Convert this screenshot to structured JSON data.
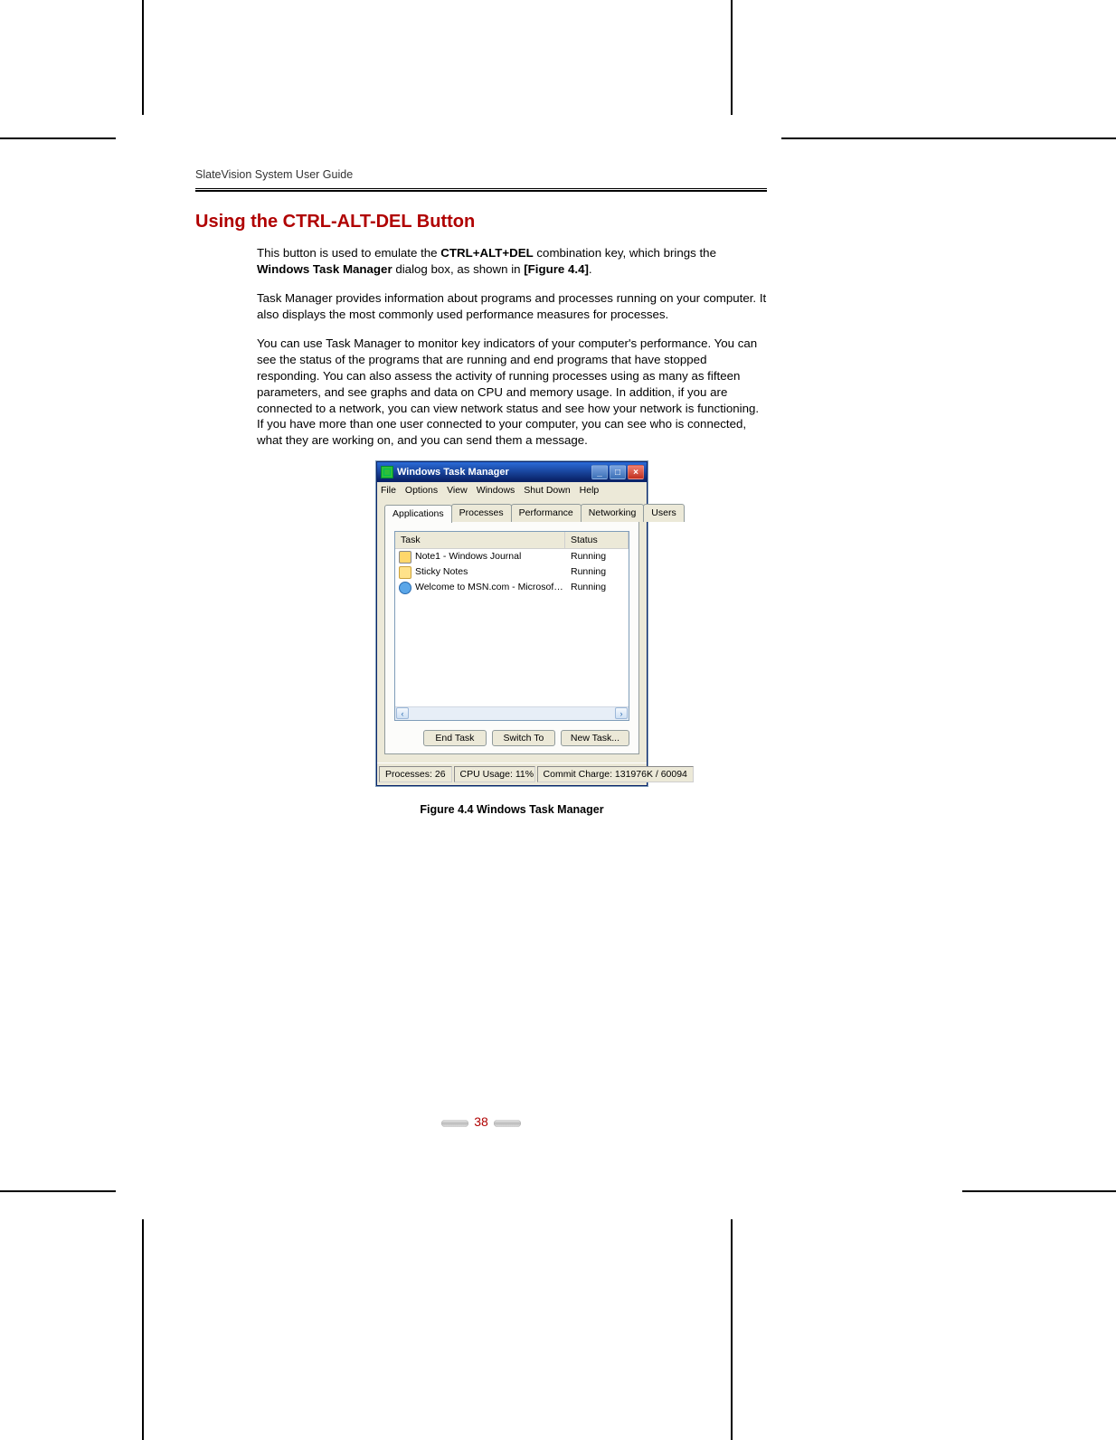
{
  "running_head": "SlateVision System User Guide",
  "heading": "Using the CTRL-ALT-DEL Button",
  "para1_a": "This button is used to emulate the ",
  "para1_b": "CTRL+ALT+DEL",
  "para1_c": " combination key, which brings the ",
  "para1_d": "Windows Task Manager",
  "para1_e": " dialog box, as shown in ",
  "para1_f": "[Figure 4.4]",
  "para1_g": ".",
  "para2": "Task Manager provides information about programs and processes running on your computer. It also displays the most commonly used performance measures for processes.",
  "para3": "You can use Task Manager to monitor key indicators of your computer's performance. You can see the status of the programs that are running and end programs that have stopped responding. You can also assess the activity of running processes using as many as fifteen parameters, and see graphs and data on CPU and memory usage. In addition, if you are connected to a network, you can view network status and see how your network is functioning. If you have more than one user connected to your computer, you can see who is connected, what they are working on, and you can send them a message.",
  "tm": {
    "title": "Windows Task Manager",
    "win_btns": {
      "min": "_",
      "max": "□",
      "close": "×"
    },
    "menu": [
      "File",
      "Options",
      "View",
      "Windows",
      "Shut Down",
      "Help"
    ],
    "tabs": [
      "Applications",
      "Processes",
      "Performance",
      "Networking",
      "Users"
    ],
    "columns": {
      "task": "Task",
      "status": "Status"
    },
    "rows": [
      {
        "task": "Note1 - Windows Journal",
        "status": "Running"
      },
      {
        "task": "Sticky Notes",
        "status": "Running"
      },
      {
        "task": "Welcome to MSN.com - Microsoft Internet Ex...",
        "status": "Running"
      }
    ],
    "scroll": {
      "left": "‹",
      "right": "›"
    },
    "buttons": {
      "end": "End Task",
      "switch": "Switch To",
      "newtask": "New Task..."
    },
    "statusbar": {
      "processes": "Processes: 26",
      "cpu": "CPU Usage: 11%",
      "commit": "Commit Charge: 131976K / 60094"
    }
  },
  "figure_caption": "Figure 4.4 Windows Task Manager",
  "page_number": "38"
}
